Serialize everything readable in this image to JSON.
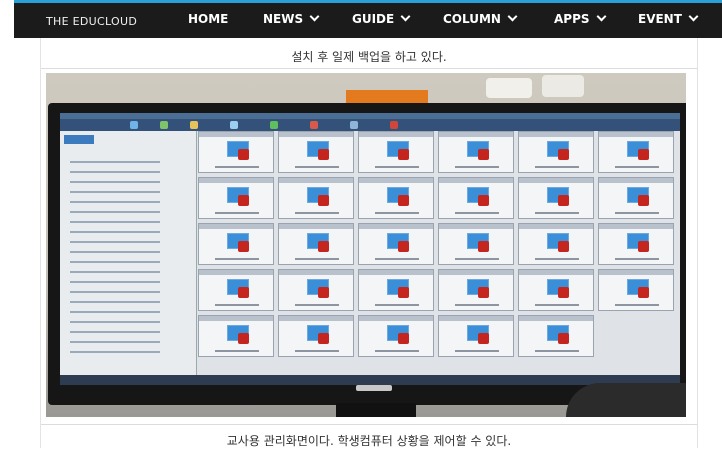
{
  "site": {
    "brand": "THE EDUCLOUD",
    "accent_color": "#2aa1d6",
    "nav": [
      {
        "label": "HOME",
        "has_dropdown": false
      },
      {
        "label": "NEWS",
        "has_dropdown": true
      },
      {
        "label": "GUIDE",
        "has_dropdown": true
      },
      {
        "label": "COLUMN",
        "has_dropdown": true
      },
      {
        "label": "APPS",
        "has_dropdown": true
      },
      {
        "label": "EVENT",
        "has_dropdown": true
      }
    ]
  },
  "article": {
    "caption_top": "설치 후 일제 백업을 하고 있다.",
    "caption_bottom": "교사용 관리화면이다. 학생컴퓨터 상황을 제어할 수 있다."
  },
  "photo": {
    "subject": "monitor-showing-teacher-management-screen",
    "pc_tiles": 29
  }
}
